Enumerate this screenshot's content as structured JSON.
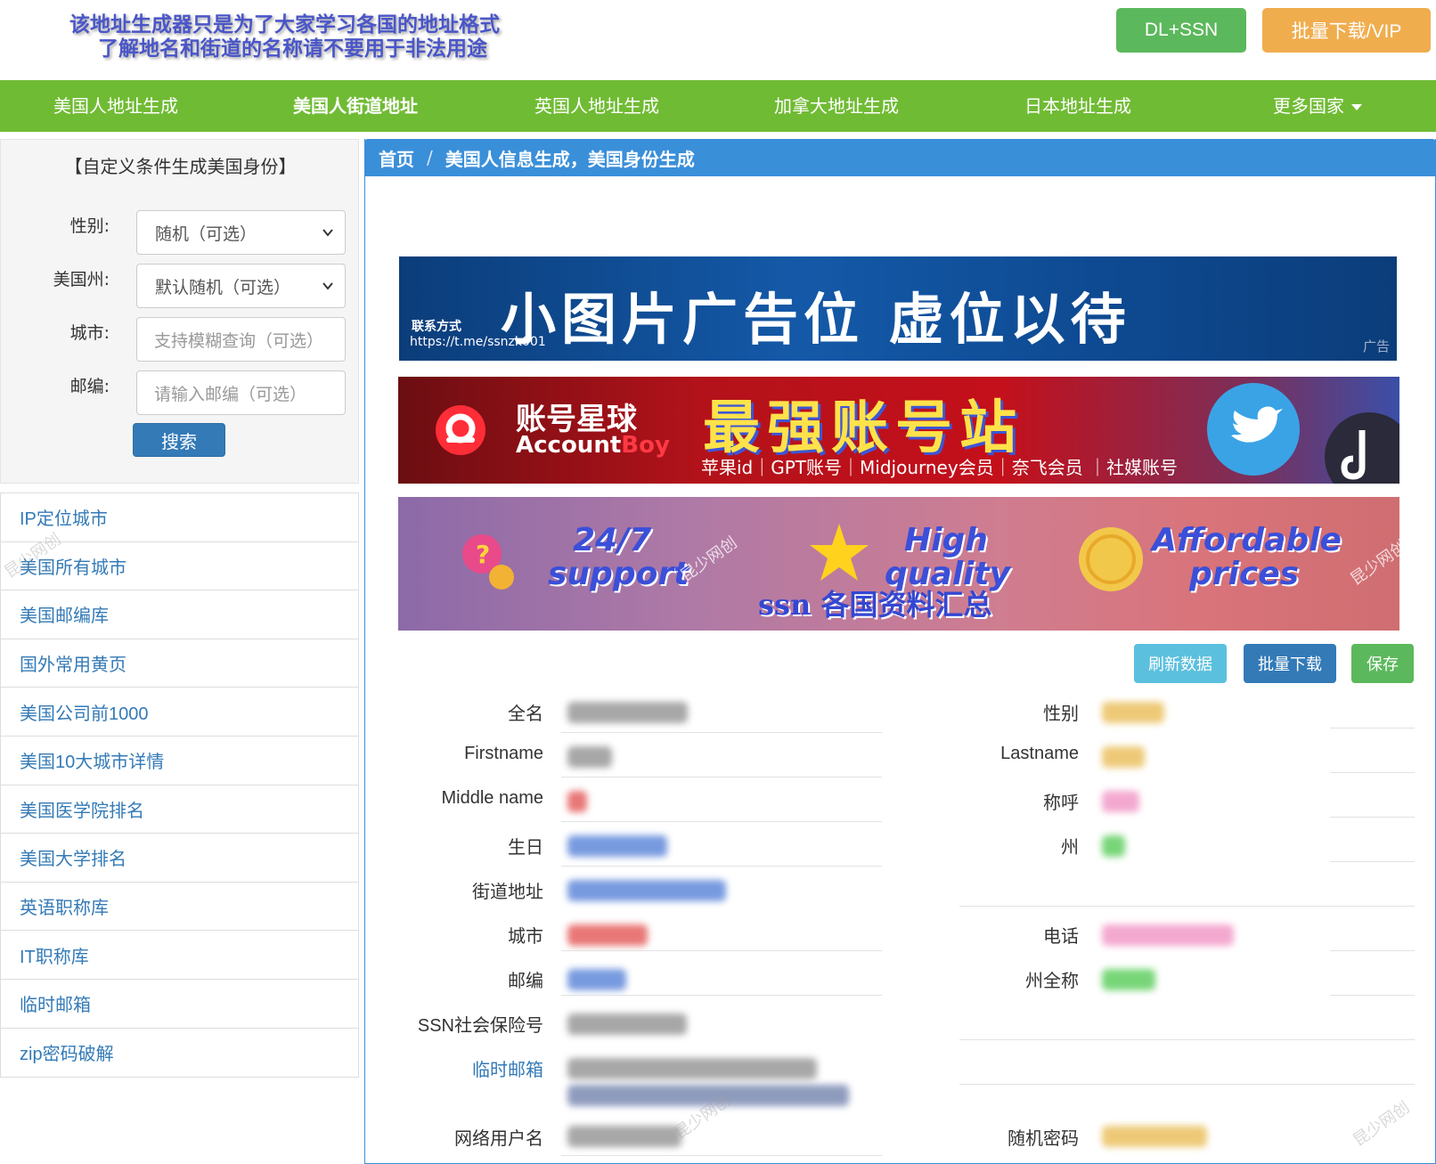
{
  "header": {
    "slogan_line1": "该地址生成器只是为了大家学习各国的地址格式",
    "slogan_line2": "了解地名和街道的名称请不要用于非法用途",
    "btn_dl_ssn": "DL+SSN",
    "btn_vip": "批量下载/VIP"
  },
  "nav": {
    "items": [
      "美国人地址生成",
      "美国人街道地址",
      "英国人地址生成",
      "加拿大地址生成",
      "日本地址生成",
      "更多国家"
    ],
    "active_index": 1
  },
  "form": {
    "title": "【自定义条件生成美国身份】",
    "gender_label": "性别:",
    "gender_value": "随机（可选）",
    "state_label": "美国州:",
    "state_value": "默认随机（可选）",
    "city_label": "城市:",
    "city_placeholder": "支持模糊查询（可选）",
    "zip_label": "邮编:",
    "zip_placeholder": "请输入邮编（可选）",
    "search_label": "搜索"
  },
  "links": [
    "IP定位城市",
    "美国所有城市",
    "美国邮编库",
    "国外常用黄页",
    "美国公司前1000",
    "美国10大城市详情",
    "美国医学院排名",
    "美国大学排名",
    "英语职称库",
    "IT职称库",
    "临时邮箱",
    "zip密码破解"
  ],
  "breadcrumb": {
    "home": "首页",
    "sep": "/",
    "current": "美国人信息生成，美国身份生成"
  },
  "ads": {
    "ad1_contact": "联系方式",
    "ad1_url": "https://t.me/ssnzk001",
    "ad1_title": "小图片广告位 虚位以待",
    "ad1_tag": "广告",
    "ad2_brand_cn": "账号星球",
    "ad2_brand_en1": "Account",
    "ad2_brand_en2": "Boy",
    "ad2_title": "最强账号站",
    "ad2_sub": "苹果id｜GPT账号｜Midjourney会员｜奈飞会员 ｜社媒账号",
    "ad3_t1a": "24/7",
    "ad3_t1b": "support",
    "ad3_t2a": "High",
    "ad3_t2b": "quality",
    "ad3_t3a": "Affordable",
    "ad3_t3b": "prices",
    "ad3_center": "ssn 各国资料汇总",
    "watermark": "昆少网创"
  },
  "actions": {
    "refresh": "刷新数据",
    "batch": "批量下载",
    "save": "保存"
  },
  "fields_left": [
    "全名",
    "Firstname",
    "Middle name",
    "生日",
    "街道地址",
    "城市",
    "邮编",
    "SSN社会保险号",
    "临时邮箱",
    "网络用户名"
  ],
  "fields_right": [
    "性别",
    "Lastname",
    "称呼",
    "州",
    "",
    "电话",
    "州全称",
    "",
    "",
    "随机密码"
  ],
  "colors": {
    "nav_green": "#70bb34",
    "primary_blue": "#337ab7",
    "breadcrumb_blue": "#3a8fd9",
    "btn_green": "#5cb85c",
    "btn_orange": "#f0ad4e",
    "btn_info": "#5bc0de"
  }
}
